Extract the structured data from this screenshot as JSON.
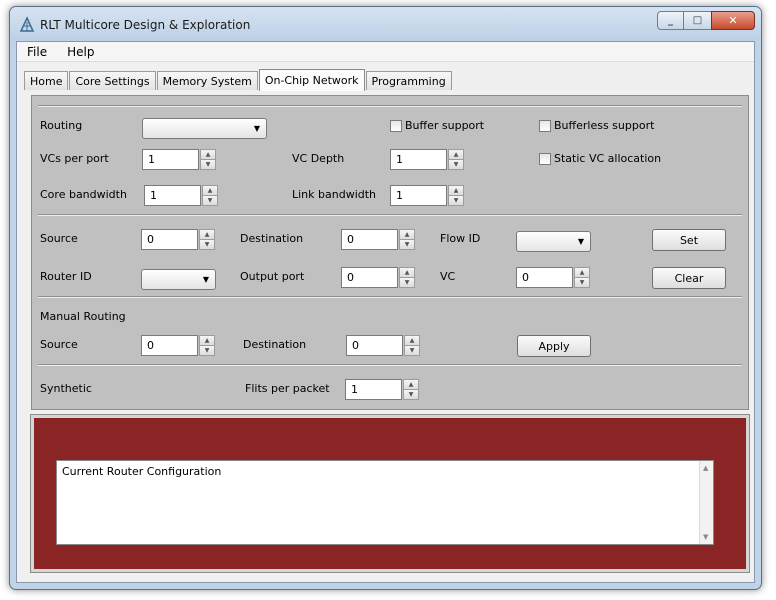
{
  "window": {
    "title": "RLT Multicore Design & Exploration"
  },
  "menu": {
    "file": "File",
    "help": "Help"
  },
  "tabs": [
    "Home",
    "Core Settings",
    "Memory System",
    "On-Chip Network",
    "Programming"
  ],
  "section1": {
    "routing_label": "Routing",
    "routing_value": "",
    "buffer_support": "Buffer support",
    "bufferless_support": "Bufferless support",
    "vcs_label": "VCs per port",
    "vcs_value": "1",
    "vc_depth_label": "VC Depth",
    "vc_depth_value": "1",
    "static_vc": "Static VC allocation",
    "core_bw_label": "Core bandwidth",
    "core_bw_value": "1",
    "link_bw_label": "Link bandwidth",
    "link_bw_value": "1"
  },
  "section2": {
    "source_label": "Source",
    "source_value": "0",
    "dest_label": "Destination",
    "dest_value": "0",
    "flow_label": "Flow ID",
    "flow_value": "",
    "set_button": "Set",
    "router_label": "Router ID",
    "router_value": "",
    "output_label": "Output port",
    "output_value": "0",
    "vc_label": "VC",
    "vc_value": "0",
    "clear_button": "Clear"
  },
  "section3": {
    "heading": "Manual Routing",
    "source_label": "Source",
    "source_value": "0",
    "dest_label": "Destination",
    "dest_value": "0",
    "apply_button": "Apply"
  },
  "section4": {
    "synthetic_label": "Synthetic",
    "flits_label": "Flits per packet",
    "flits_value": "1"
  },
  "log": {
    "text": "Current Router Configuration"
  },
  "colors": {
    "log_panel": "#8b2424",
    "pane": "#c0c0c0"
  },
  "icons": {
    "app": "circuit-icon",
    "minimize": "minimize-icon",
    "maximize": "maximize-icon",
    "close": "close-icon",
    "spin_up": "arrow-up-icon",
    "spin_down": "arrow-down-icon",
    "dropdown": "chevron-down-icon"
  }
}
